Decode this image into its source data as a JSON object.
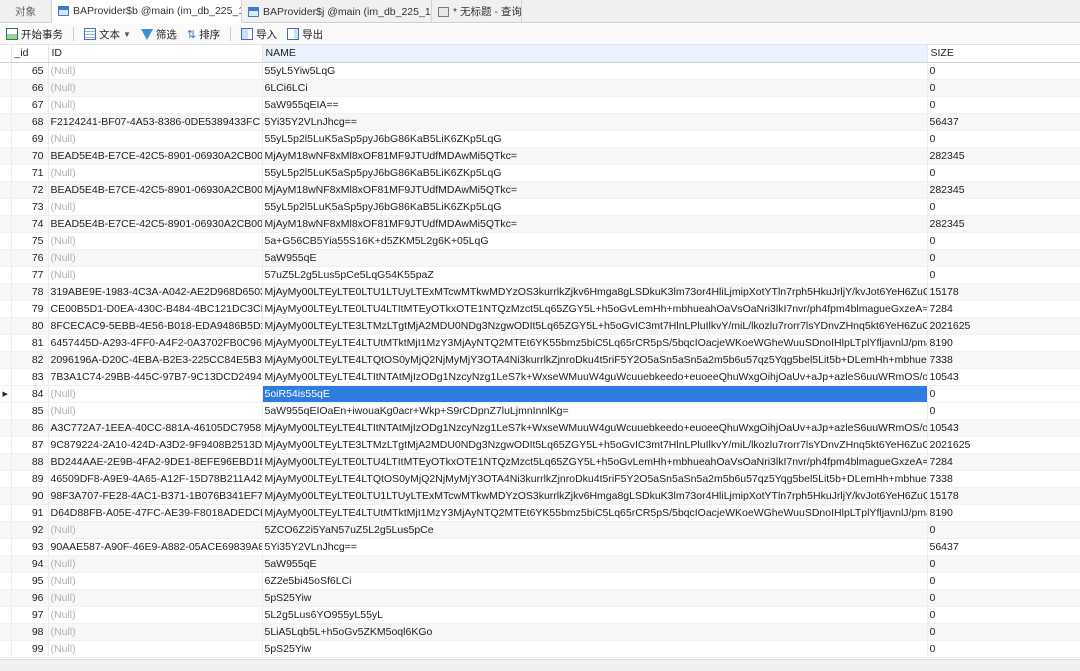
{
  "tabs": [
    {
      "label": "对象",
      "icon": "",
      "active": false
    },
    {
      "label": "BAProvider$b @main (im_db_225_18...",
      "icon": "table-icon",
      "active": true
    },
    {
      "label": "BAProvider$j @main (im_db_225_18...",
      "icon": "table-icon",
      "active": false
    },
    {
      "label": "* 无标题 - 查询",
      "icon": "query-icon",
      "active": false
    }
  ],
  "toolbar": {
    "begin_label": "开始事务",
    "text_label": "文本",
    "filter_label": "筛选",
    "sort_label": "排序",
    "import_label": "导入",
    "export_label": "导出"
  },
  "columns": [
    "_id",
    "ID",
    "NAME",
    "SIZE"
  ],
  "null_text": "(Null)",
  "selected_row": "84",
  "rows": [
    {
      "_id": "65",
      "ID": null,
      "NAME": "55yL5Yiw5LqG",
      "SIZE": "0"
    },
    {
      "_id": "66",
      "ID": null,
      "NAME": "6LCi6LCi",
      "SIZE": "0"
    },
    {
      "_id": "67",
      "ID": null,
      "NAME": "5aW955qEIA==",
      "SIZE": "0"
    },
    {
      "_id": "68",
      "ID": "F2124241-BF07-4A53-8386-0DE5389433FC",
      "NAME": "5Yi35Y2VLnJhcg==",
      "SIZE": "56437"
    },
    {
      "_id": "69",
      "ID": null,
      "NAME": "55yL5p2l5LuK5aSp5pyJ6bG86KaB5LiK6ZKp5LqG",
      "SIZE": "0"
    },
    {
      "_id": "70",
      "ID": "BEAD5E4B-E7CE-42C5-8901-06930A2CB00C",
      "NAME": "MjAyM18wNF8xMl8xOF81MF9JTUdfMDAwMi5QTkc=",
      "SIZE": "282345"
    },
    {
      "_id": "71",
      "ID": null,
      "NAME": "55yL5p2l5LuK5aSp5pyJ6bG86KaB5LiK6ZKp5LqG",
      "SIZE": "0"
    },
    {
      "_id": "72",
      "ID": "BEAD5E4B-E7CE-42C5-8901-06930A2CB00C",
      "NAME": "MjAyM18wNF8xMl8xOF81MF9JTUdfMDAwMi5QTkc=",
      "SIZE": "282345"
    },
    {
      "_id": "73",
      "ID": null,
      "NAME": "55yL5p2l5LuK5aSp5pyJ6bG86KaB5LiK6ZKp5LqG",
      "SIZE": "0"
    },
    {
      "_id": "74",
      "ID": "BEAD5E4B-E7CE-42C5-8901-06930A2CB00C",
      "NAME": "MjAyM18wNF8xMl8xOF81MF9JTUdfMDAwMi5QTkc=",
      "SIZE": "282345"
    },
    {
      "_id": "75",
      "ID": null,
      "NAME": "5a+G56CB5Yia55S16K+d5ZKM5L2g6K+05LqG",
      "SIZE": "0"
    },
    {
      "_id": "76",
      "ID": null,
      "NAME": "5aW955qE",
      "SIZE": "0"
    },
    {
      "_id": "77",
      "ID": null,
      "NAME": "57uZ5L2g5Lus5pCe5LqG54K55paZ",
      "SIZE": "0"
    },
    {
      "_id": "78",
      "ID": "319ABE9E-1983-4C3A-A042-AE2D968D6503",
      "NAME": "MjAyMy00LTEyLTE0LTU1LTUyLTExMTcwMTkwMDYzOS3kurrlkZjkv6Hmga8gLSDkuK3lm73or4HliLjmipXotYTln7rph5HkuJrljY/kvJot6YeH6ZuG55qE5pWl",
      "SIZE": "15178"
    },
    {
      "_id": "79",
      "ID": "CE00B5D1-D0EA-430C-B484-4BC121DC3CE2",
      "NAME": "MjAyMy00LTEyLTE0LTU4LTItMTEyOTkxOTE1NTQzMzct5Lq65ZGY5L+h5oGvLemHh+mbhueahOaVsOaNri3lkI7nvr/ph4fpm4blmagueGxzeA==",
      "SIZE": "7284"
    },
    {
      "_id": "80",
      "ID": "8FCECAC9-5EBB-4E56-B018-EDA9486B5D25",
      "NAME": "MjAyMy00LTEyLTE3LTMzLTgtMjA2MDU0NDg3NzgwODIt5Lq65ZGY5L+h5oGvIC3mt7HlnLPluIlkvY/miL/lkozlu7rorr7lsYDnvZHnq5kt6YeH6ZuG55qE5pW",
      "SIZE": "2021625"
    },
    {
      "_id": "81",
      "ID": "6457445D-A293-4FF0-A4F2-0A3702FB0C96",
      "NAME": "MjAyMy00LTEyLTE4LTUtMTktMjI1MzY3MjAyNTQ2MTEt6YK55bmz5biC5Lq65rCR5pS/5bqcIOacjeWKoeWGheWuuSDnoIHlpLTplYfljavnlJ/pmaLln7rmn",
      "SIZE": "8190"
    },
    {
      "_id": "82",
      "ID": "2096196A-D20C-4EBA-B2E3-225CC84E5B32",
      "NAME": "MjAyMy00LTEyLTE4LTQtOS0yMjQ2NjMyMjY3OTA4Ni3kurrlkZjnroDku4t5riF5Y2O5aSn5aSn5a2m5b6u57qz5Yqg5bel5Lit5b+DLemHh+mbhueahOaVsOaN",
      "SIZE": "7338"
    },
    {
      "_id": "83",
      "ID": "7B3A1C74-29BB-445C-97B7-9C13DCD24940",
      "NAME": "MjAyMy00LTEyLTE4LTItNTAtMjIzODg1NzcyNzg1LeS7k+WxseWMuuW4guWcuuebkeedo+euoeeQhuWxgOihjOaUv+aJp+azleS6uuWRmOS/oeaBr+S",
      "SIZE": "10543"
    },
    {
      "_id": "84",
      "ID": null,
      "NAME": "5oiR54is55qE",
      "SIZE": "0"
    },
    {
      "_id": "85",
      "ID": null,
      "NAME": "5aW955qEIOaEn+iwouaKg0acr+Wkp+S9rCDpnZ7luLjmnInnlKg=",
      "SIZE": "0"
    },
    {
      "_id": "86",
      "ID": "A3C772A7-1EEA-40CC-881A-46105DC79581",
      "NAME": "MjAyMy00LTEyLTE4LTItNTAtMjIzODg1NzcyNzg1LeS7k+WxseWMuuW4guWcuuebkeedo+euoeeQhuWxgOihjOaUv+aJp+azleS6uuWRmOS/oeaBr+S",
      "SIZE": "10543"
    },
    {
      "_id": "87",
      "ID": "9C879224-2A10-424D-A3D2-9F9408B2513D",
      "NAME": "MjAyMy00LTEyLTE3LTMzLTgtMjA2MDU0NDg3NzgwODIt5Lq65ZGY5L+h5oGvIC3mt7HlnLPluIlkvY/miL/lkozlu7rorr7lsYDnvZHnq5kt6YeH6ZuG55qE5pW",
      "SIZE": "2021625"
    },
    {
      "_id": "88",
      "ID": "BD244AAE-2E9B-4FA2-9DE1-8EFE96EBD1BD",
      "NAME": "MjAyMy00LTEyLTE0LTU4LTItMTEyOTkxOTE1NTQzMzct5Lq65ZGY5L+h5oGvLemHh+mbhueahOaVsOaNri3lkI7nvr/ph4fpm4blmagueGxzeA==",
      "SIZE": "7284"
    },
    {
      "_id": "89",
      "ID": "46509DF8-A9E9-4A65-A12F-15D78B211A42",
      "NAME": "MjAyMy00LTEyLTE4LTQtOS0yMjQ2NjMyMjY3OTA4Ni3kurrlkZjnroDku4t5riF5Y2O5aSn5aSn5a2m5b6u57qz5Yqg5bel5Lit5b+DLemHh+mbhueahOaVsOaN",
      "SIZE": "7338"
    },
    {
      "_id": "90",
      "ID": "98F3A707-FE28-4AC1-B371-1B076B341EF7",
      "NAME": "MjAyMy00LTEyLTE0LTU1LTUyLTExMTcwMTkwMDYzOS3kurrlkZjkv6Hmga8gLSDkuK3lm73or4HliLjmipXotYTln7rph5HkuJrljY/kvJot6YeH6ZuG55qE5pWl",
      "SIZE": "15178"
    },
    {
      "_id": "91",
      "ID": "D64D88FB-A05E-47FC-AE39-F8018ADEDCE8",
      "NAME": "MjAyMy00LTEyLTE4LTUtMTktMjI1MzY3MjAyNTQ2MTEt6YK55bmz5biC5Lq65rCR5pS/5bqcIOacjeWKoeWGheWuuSDnoIHlpLTplYfljavnlJ/pmaLln7rmn",
      "SIZE": "8190"
    },
    {
      "_id": "92",
      "ID": null,
      "NAME": "5ZCO6Z2i5YaN57uZ5L2g5Lus5pCe",
      "SIZE": "0"
    },
    {
      "_id": "93",
      "ID": "90AAE587-A90F-46E9-A882-05ACE69839A8",
      "NAME": "5Yi35Y2VLnJhcg==",
      "SIZE": "56437"
    },
    {
      "_id": "94",
      "ID": null,
      "NAME": "5aW955qE",
      "SIZE": "0"
    },
    {
      "_id": "95",
      "ID": null,
      "NAME": "6Z2e5bi45oSf6LCi",
      "SIZE": "0"
    },
    {
      "_id": "96",
      "ID": null,
      "NAME": "5pS25Yiw",
      "SIZE": "0"
    },
    {
      "_id": "97",
      "ID": null,
      "NAME": "5L2g5Lus6YO955yL55yL",
      "SIZE": "0"
    },
    {
      "_id": "98",
      "ID": null,
      "NAME": "5LiA5Lqb5L+h5oGv5ZKM5oql6KGo",
      "SIZE": "0"
    },
    {
      "_id": "99",
      "ID": null,
      "NAME": "5pS25Yiw",
      "SIZE": "0"
    }
  ]
}
